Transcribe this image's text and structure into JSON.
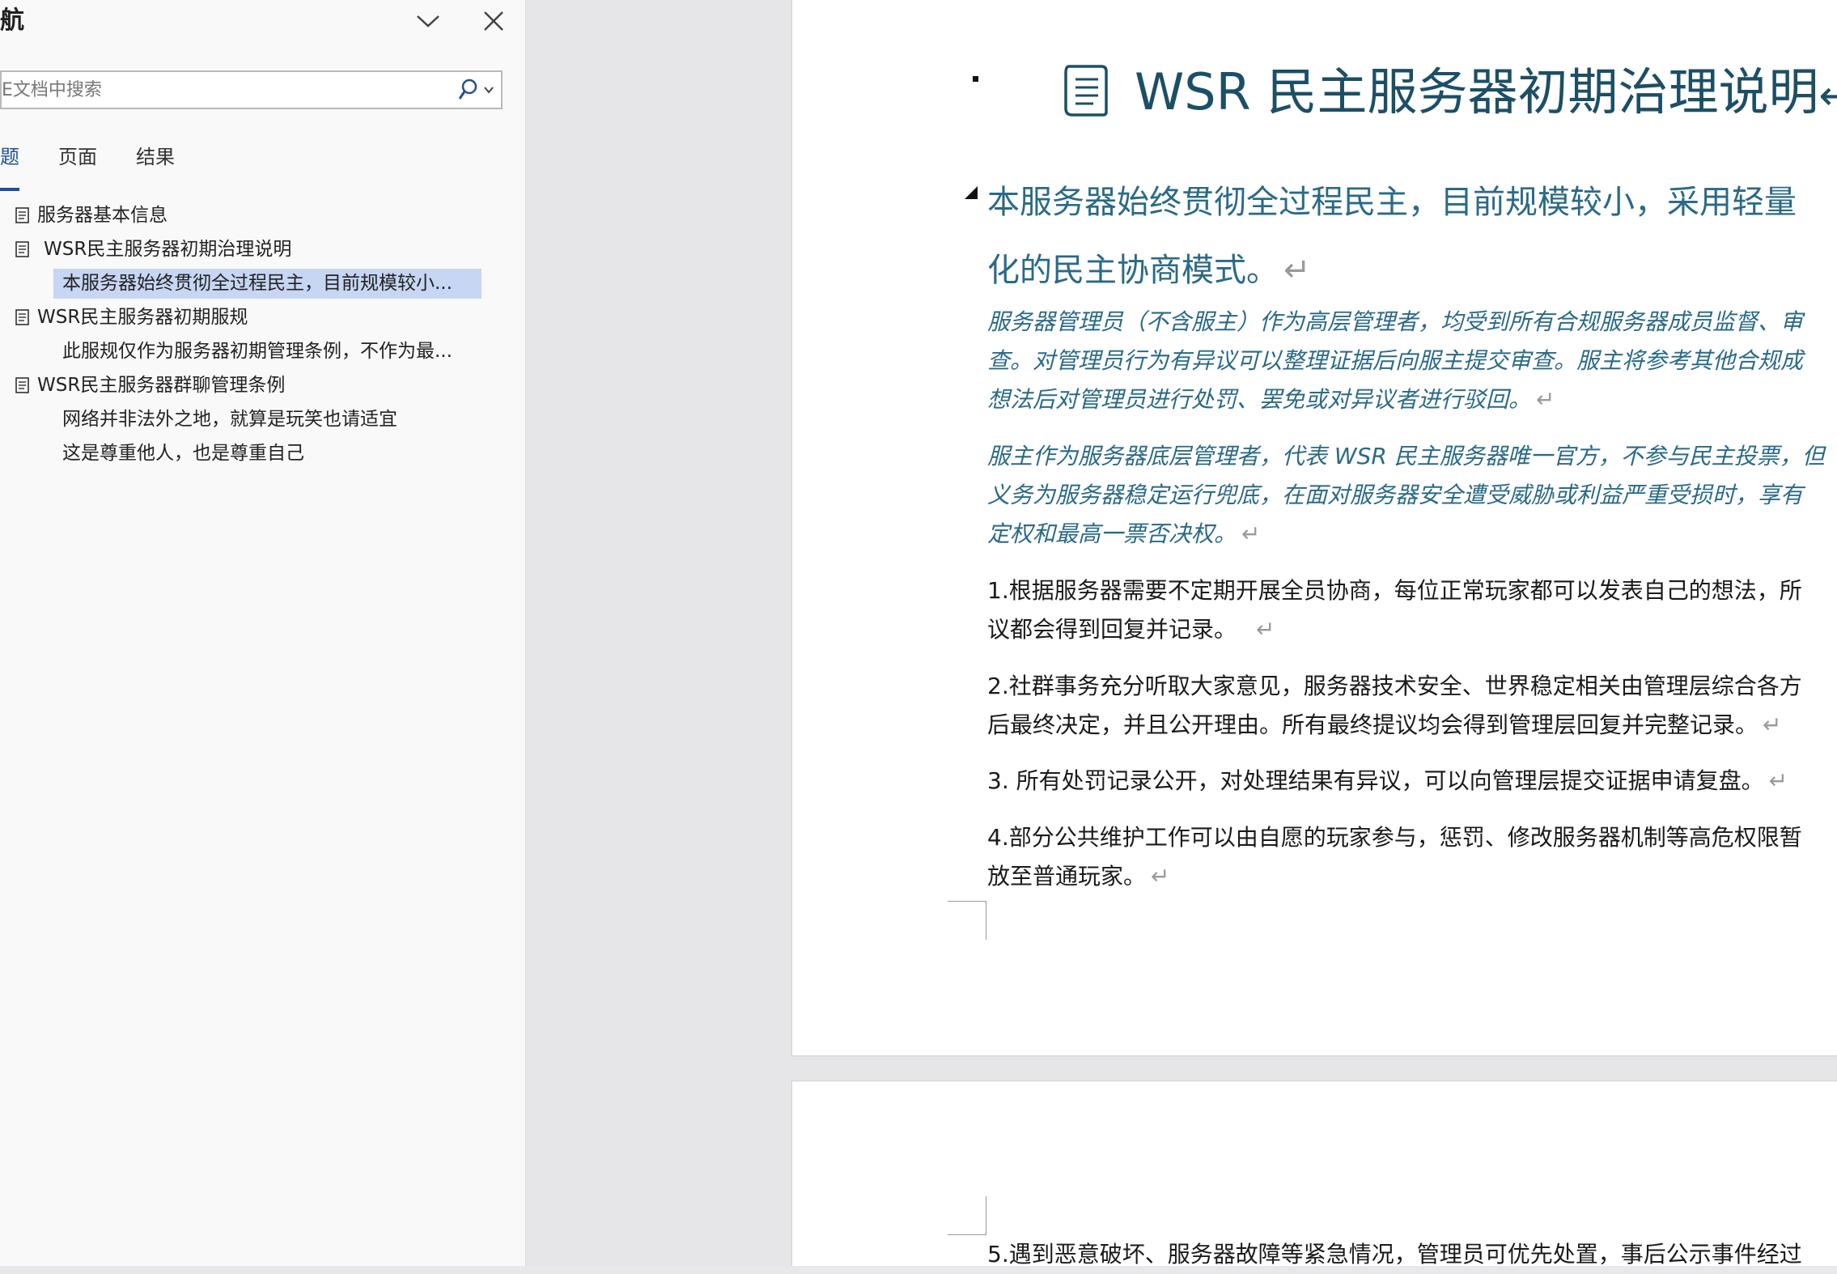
{
  "nav": {
    "title": "航",
    "search_placeholder": "E文档中搜索",
    "tabs": [
      "题",
      "页面",
      "结果"
    ],
    "outline": [
      {
        "label": "服务器基本信息",
        "level": 1
      },
      {
        "label": "WSR民主服务器初期治理说明",
        "level": 1
      },
      {
        "label": "本服务器始终贯彻全过程民主，目前规模较小...",
        "level": 2,
        "selected": true
      },
      {
        "label": "WSR民主服务器初期服规",
        "level": 1
      },
      {
        "label": "此服规仅作为服务器初期管理条例，不作为最...",
        "level": 2
      },
      {
        "label": "WSR民主服务器群聊管理条例",
        "level": 1
      },
      {
        "label": "网络并非法外之地，就算是玩笑也请适宜",
        "level": 2
      },
      {
        "label": "这是尊重他人，也是尊重自己",
        "level": 2
      }
    ]
  },
  "document": {
    "title": "WSR 民主服务器初期治理说明",
    "title_mark": "←",
    "heading2_line1": "本服务器始终贯彻全过程民主，目前规模较小，采用轻量",
    "heading2_line2": "化的民主协商模式。",
    "paragraphs": [
      {
        "style": "italic",
        "lines": [
          "服务器管理员（不含服主）作为高层管理者，均受到所有合规服务器成员监督、审",
          "查。对管理员行为有异议可以整理证据后向服主提交审查。服主将参考其他合规成",
          "想法后对管理员进行处罚、罢免或对异议者进行驳回。"
        ]
      },
      {
        "style": "italic",
        "lines": [
          "服主作为服务器底层管理者，代表 WSR 民主服务器唯一官方，不参与民主投票，但",
          "义务为服务器稳定运行兜底，在面对服务器安全遭受威胁或利益严重受损时，享有",
          "定权和最高一票否决权。"
        ]
      },
      {
        "style": "normal",
        "lines": [
          "1.根据服务器需要不定期开展全员协商，每位正常玩家都可以发表自己的想法，所",
          "议都会得到回复并记录。"
        ]
      },
      {
        "style": "normal",
        "lines": [
          "2.社群事务充分听取大家意见，服务器技术安全、世界稳定相关由管理层综合各方",
          "后最终决定，并且公开理由。所有最终提议均会得到管理层回复并完整记录。"
        ]
      },
      {
        "style": "normal",
        "lines": [
          "3. 所有处罚记录公开，对处理结果有异议，可以向管理层提交证据申请复盘。"
        ]
      },
      {
        "style": "normal",
        "lines": [
          "4.部分公共维护工作可以由自愿的玩家参与，惩罚、修改服务器机制等高危权限暂",
          "放至普通玩家。"
        ]
      }
    ],
    "page2_line": "5.遇到恶意破坏、服务器故障等紧急情况，管理员可优先处置，事后公示事件经过",
    "para_mark": "↵"
  }
}
